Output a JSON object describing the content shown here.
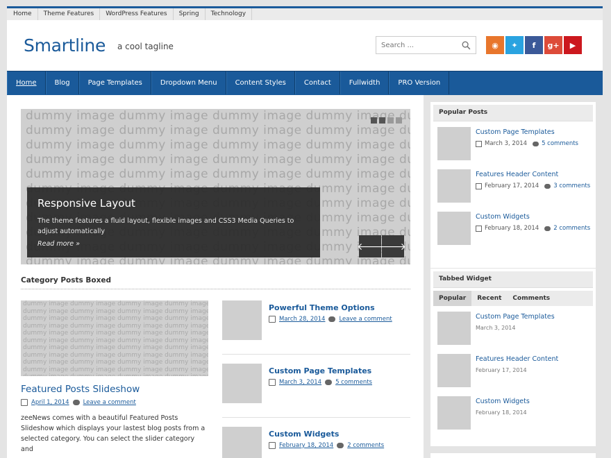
{
  "topnav": [
    "Home",
    "Theme Features",
    "WordPress Features",
    "Spring",
    "Technology"
  ],
  "header": {
    "site_title": "Smartline",
    "tagline": "a cool tagline",
    "search_placeholder": "Search ...",
    "socials": [
      {
        "name": "rss-icon",
        "glyph": "◉",
        "color": "#e8762c"
      },
      {
        "name": "twitter-icon",
        "glyph": "✦",
        "color": "#2aa3e0"
      },
      {
        "name": "facebook-icon",
        "glyph": "f",
        "color": "#3b5998"
      },
      {
        "name": "googleplus-icon",
        "glyph": "g+",
        "color": "#dd4b39"
      },
      {
        "name": "youtube-icon",
        "glyph": "▶",
        "color": "#cc181e"
      }
    ]
  },
  "mainnav": [
    "Home",
    "Blog",
    "Page Templates",
    "Dropdown Menu",
    "Content Styles",
    "Contact",
    "Fullwidth",
    "PRO Version"
  ],
  "slider": {
    "watermark": "dummy image",
    "title": "Responsive Layout",
    "text": "The theme features a fluid layout, flexible images and CSS3 Media Queries to adjust automatically",
    "read_more": "Read more »"
  },
  "category": {
    "title": "Category Posts Boxed",
    "featured": {
      "title": "Featured Posts Slideshow",
      "date": "April 1, 2014",
      "comments": "Leave a comment",
      "excerpt": "zeeNews comes with a beautiful Featured Posts Slideshow which displays your lastest blog posts from a selected category. You can select the slider category and"
    },
    "posts": [
      {
        "title": "Powerful Theme Options",
        "date": "March 28, 2014",
        "comments": "Leave a comment"
      },
      {
        "title": "Custom Page Templates",
        "date": "March 3, 2014",
        "comments": "5 comments"
      },
      {
        "title": "Custom Widgets",
        "date": "February 18, 2014",
        "comments": "2 comments"
      }
    ]
  },
  "popular": {
    "title": "Popular Posts",
    "posts": [
      {
        "title": "Custom Page Templates",
        "date": "March 3, 2014",
        "comments": "5 comments"
      },
      {
        "title": "Features Header Content",
        "date": "February 17, 2014",
        "comments": "3 comments"
      },
      {
        "title": "Custom Widgets",
        "date": "February 18, 2014",
        "comments": "2 comments"
      }
    ]
  },
  "tabbed": {
    "title": "Tabbed Widget",
    "tabs": [
      "Popular",
      "Recent",
      "Comments"
    ],
    "posts": [
      {
        "title": "Custom Page Templates",
        "date": "March 3, 2014"
      },
      {
        "title": "Features Header Content",
        "date": "February 17, 2014"
      },
      {
        "title": "Custom Widgets",
        "date": "February 18, 2014"
      }
    ]
  }
}
